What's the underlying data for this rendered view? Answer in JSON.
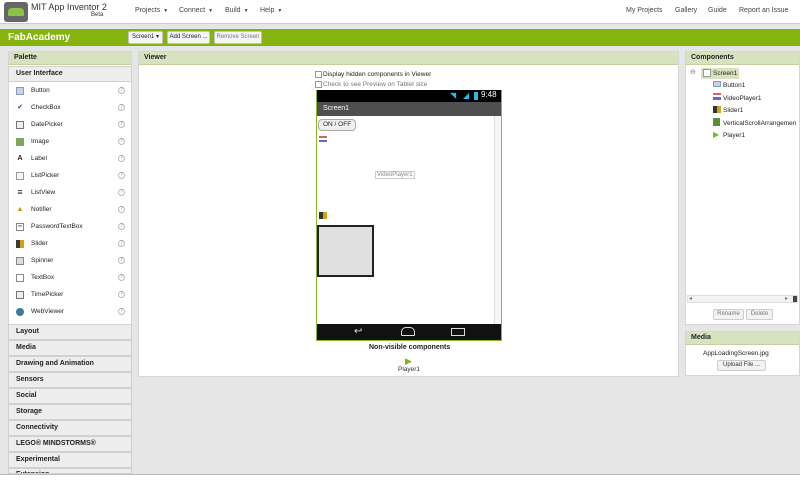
{
  "app": {
    "title": "MIT App Inventor 2",
    "beta": "Beta"
  },
  "topmenu": [
    {
      "label": "Projects"
    },
    {
      "label": "Connect"
    },
    {
      "label": "Build"
    },
    {
      "label": "Help"
    }
  ],
  "rightlinks": [
    "My Projects",
    "Gallery",
    "Guide",
    "Report an Issue"
  ],
  "project": {
    "name": "FabAcademy",
    "screen_select": "Screen1",
    "add_screen": "Add Screen ...",
    "remove_screen": "Remove Screen"
  },
  "palette": {
    "title": "Palette",
    "open_category": "User Interface",
    "items": [
      {
        "label": "Button",
        "icon": "button-icon"
      },
      {
        "label": "CheckBox",
        "icon": "checkbox-icon"
      },
      {
        "label": "DatePicker",
        "icon": "datepicker-icon"
      },
      {
        "label": "Image",
        "icon": "image-icon"
      },
      {
        "label": "Label",
        "icon": "label-icon"
      },
      {
        "label": "ListPicker",
        "icon": "listpicker-icon"
      },
      {
        "label": "ListView",
        "icon": "listview-icon"
      },
      {
        "label": "Notifier",
        "icon": "notifier-icon"
      },
      {
        "label": "PasswordTextBox",
        "icon": "password-icon"
      },
      {
        "label": "Slider",
        "icon": "slider-icon"
      },
      {
        "label": "Spinner",
        "icon": "spinner-icon"
      },
      {
        "label": "TextBox",
        "icon": "textbox-icon"
      },
      {
        "label": "TimePicker",
        "icon": "timepicker-icon"
      },
      {
        "label": "WebViewer",
        "icon": "webviewer-icon"
      }
    ],
    "help_glyph": "?",
    "categories": [
      "Layout",
      "Media",
      "Drawing and Animation",
      "Sensors",
      "Social",
      "Storage",
      "Connectivity",
      "LEGO® MINDSTORMS®",
      "Experimental",
      "Extension"
    ]
  },
  "viewer": {
    "title": "Viewer",
    "display_hidden": "Display hidden components in Viewer",
    "tablet_preview": "Check to see Preview on Tablet size",
    "phone_time": "9:48",
    "screen_title": "Screen1",
    "on_off_button": "ON / OFF",
    "video_player_label": "VideoPlayer1",
    "nonvisible_title": "Non-visible components",
    "nonvisible_item": "Player1"
  },
  "components": {
    "title": "Components",
    "tree": [
      "Screen1",
      "Button1",
      "VideoPlayer1",
      "Slider1",
      "VerticalScrollArrangemen",
      "Player1"
    ],
    "rename": "Rename",
    "delete": "Delete"
  },
  "media": {
    "title": "Media",
    "file": "AppLoadingScreen.jpg",
    "upload": "Upload File ..."
  },
  "colors": {
    "accent": "#86b30f",
    "panel_header": "#d7e3bf"
  }
}
